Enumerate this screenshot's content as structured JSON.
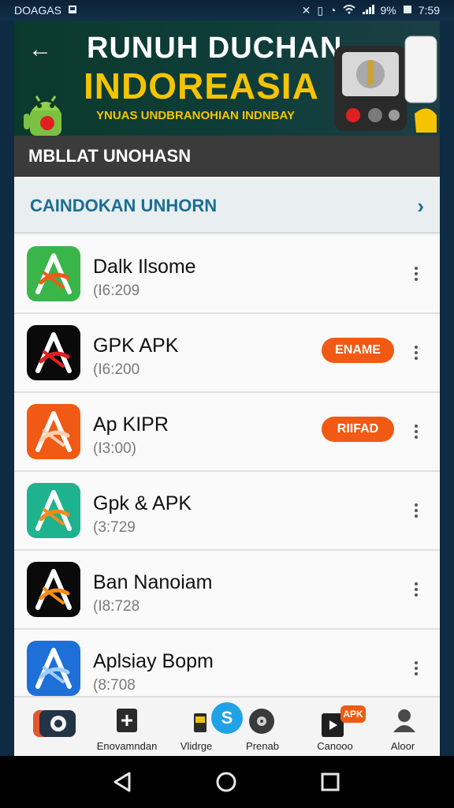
{
  "status_bar": {
    "carrier": "DOAGAS",
    "battery": "9%",
    "time": "7:59"
  },
  "banner": {
    "title": "RUNUH DUCHAN",
    "subtitle": "INDOREASIA",
    "tagline": "YNUAS UNDBRANOHIAN INDNBAY"
  },
  "section": {
    "title": "MBLLAT UNOHASN"
  },
  "category": {
    "label": "CAINDOKAN UNHORN"
  },
  "apps": [
    {
      "name": "Dalk Ilsome",
      "meta": "(I6:209",
      "badge": "",
      "icon_bg": "#3ab54a",
      "icon_fg": "#ffffff",
      "icon_accent": "#f05a14"
    },
    {
      "name": "GPK APK",
      "meta": "(I6:200",
      "badge": "ENAME",
      "icon_bg": "#0a0a0a",
      "icon_fg": "#ffffff",
      "icon_accent": "#e02020"
    },
    {
      "name": "Ap KIPR",
      "meta": "(I3:00)",
      "badge": "RIIFAD",
      "icon_bg": "#f05a14",
      "icon_fg": "#ffffff",
      "icon_accent": "#ffd0b0"
    },
    {
      "name": "Gpk & APK",
      "meta": "(3:729",
      "badge": "",
      "icon_bg": "#1fb28f",
      "icon_fg": "#ffffff",
      "icon_accent": "#f28c1a"
    },
    {
      "name": "Ban Nanoiam",
      "meta": "(I8:728",
      "badge": "",
      "icon_bg": "#0a0a0a",
      "icon_fg": "#ffffff",
      "icon_accent": "#f28c1a"
    },
    {
      "name": "Aplsiay Bopm",
      "meta": "(8:708",
      "badge": "",
      "icon_bg": "#1f6fd8",
      "icon_fg": "#ffffff",
      "icon_accent": "#9ed0ff"
    }
  ],
  "bottom_nav": {
    "items": [
      {
        "label": ""
      },
      {
        "label": "Enovamndan"
      },
      {
        "label": "Vlidrge"
      },
      {
        "label": "Prenab"
      },
      {
        "label": "Canooo"
      },
      {
        "label": "Aloor"
      }
    ],
    "fab_glyph": "S",
    "badge": "APK"
  }
}
